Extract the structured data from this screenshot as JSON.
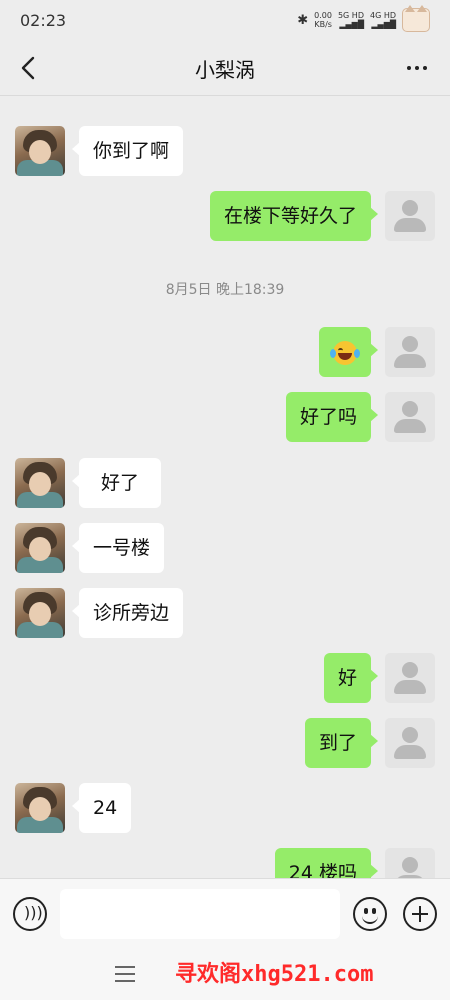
{
  "status_bar": {
    "time": "02:23",
    "net_speed": "0.00",
    "net_unit": "KB/s",
    "signal1": "5G HD",
    "signal2": "4G HD"
  },
  "header": {
    "title": "小梨涡"
  },
  "messages": [
    {
      "side": "left",
      "text": "你到了啊"
    },
    {
      "side": "right",
      "text": "在楼下等好久了"
    },
    {
      "type": "time",
      "text": "8月5日 晚上18:39"
    },
    {
      "side": "right",
      "emoji": "laughing-tears-emoji"
    },
    {
      "side": "right",
      "text": "好了吗"
    },
    {
      "side": "left",
      "text": "好了"
    },
    {
      "side": "left",
      "text": "一号楼"
    },
    {
      "side": "left",
      "text": "诊所旁边"
    },
    {
      "side": "right",
      "text": "好"
    },
    {
      "side": "right",
      "text": "到了"
    },
    {
      "side": "left",
      "text": "24"
    },
    {
      "side": "right",
      "text": "24 楼吗"
    }
  ],
  "input_bar": {
    "value": "",
    "placeholder": ""
  },
  "watermark": "寻欢阁xhg521.com",
  "colors": {
    "background": "#ededed",
    "right_bubble": "#95ec69",
    "left_bubble": "#ffffff",
    "watermark": "#ff2a2a"
  }
}
